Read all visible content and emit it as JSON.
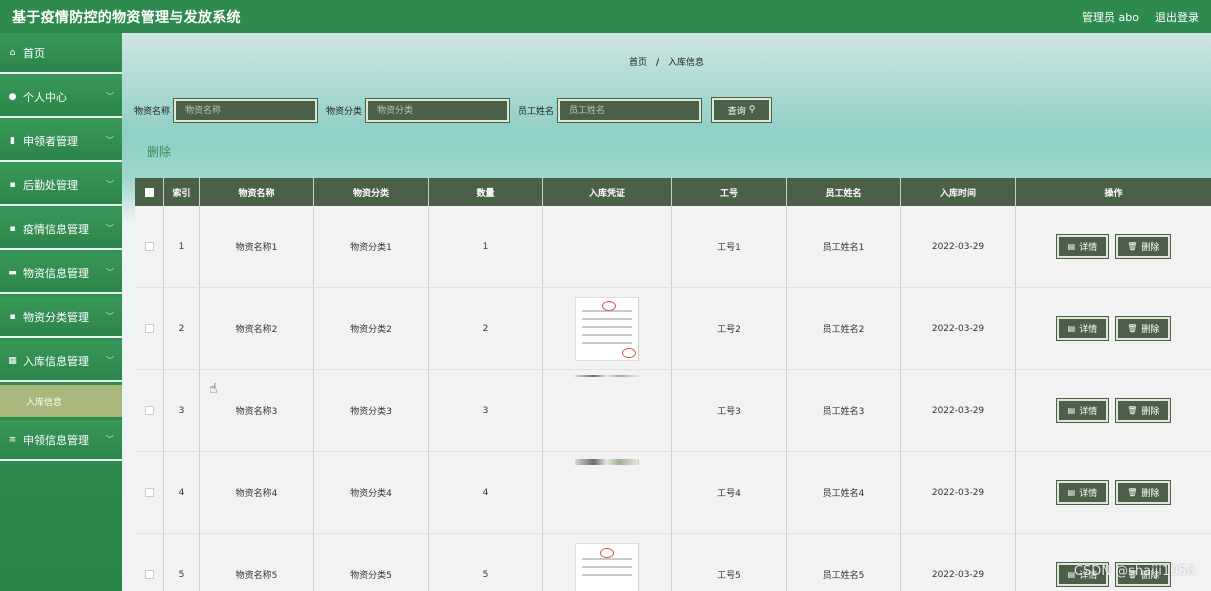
{
  "app": {
    "title": "基于疫情防控的物资管理与发放系统",
    "user_label": "管理员 abo",
    "logout_label": "退出登录"
  },
  "sidebar": {
    "items": [
      {
        "label": "首页",
        "icon": "home-icon"
      },
      {
        "label": "个人中心",
        "icon": "user-icon"
      },
      {
        "label": "申领者管理",
        "icon": "chart-icon"
      },
      {
        "label": "后勤处管理",
        "icon": "document-icon"
      },
      {
        "label": "疫情信息管理",
        "icon": "document-icon"
      },
      {
        "label": "物资信息管理",
        "icon": "box-icon"
      },
      {
        "label": "物资分类管理",
        "icon": "tag-icon"
      },
      {
        "label": "入库信息管理",
        "icon": "grid-icon"
      },
      {
        "label": "申领信息管理",
        "icon": "list-icon"
      }
    ],
    "active_sub": "入库信息"
  },
  "breadcrumb": {
    "home": "首页",
    "sep": "/",
    "current": "入库信息"
  },
  "search": {
    "name_label": "物资名称",
    "name_placeholder": "物资名称",
    "category_label": "物资分类",
    "category_placeholder": "物资分类",
    "employee_label": "员工姓名",
    "employee_placeholder": "员工姓名",
    "query_label": "查询"
  },
  "delete_link": "删除",
  "table": {
    "headers": [
      "索引",
      "物资名称",
      "物资分类",
      "数量",
      "入库凭证",
      "工号",
      "员工姓名",
      "入库时间",
      "操作"
    ],
    "detail_label": "详情",
    "delete_label": "删除",
    "rows": [
      {
        "idx": "1",
        "name": "物资名称1",
        "cat": "物资分类1",
        "qty": "1",
        "no": "工号1",
        "emp": "员工姓名1",
        "time": "2022-03-29"
      },
      {
        "idx": "2",
        "name": "物资名称2",
        "cat": "物资分类2",
        "qty": "2",
        "no": "工号2",
        "emp": "员工姓名2",
        "time": "2022-03-29"
      },
      {
        "idx": "3",
        "name": "物资名称3",
        "cat": "物资分类3",
        "qty": "3",
        "no": "工号3",
        "emp": "员工姓名3",
        "time": "2022-03-29"
      },
      {
        "idx": "4",
        "name": "物资名称4",
        "cat": "物资分类4",
        "qty": "4",
        "no": "工号4",
        "emp": "员工姓名4",
        "time": "2022-03-29"
      },
      {
        "idx": "5",
        "name": "物资名称5",
        "cat": "物资分类5",
        "qty": "5",
        "no": "工号5",
        "emp": "员工姓名5",
        "time": "2022-03-29"
      }
    ]
  },
  "watermark": "CSDN @shaiji1056",
  "colors": {
    "header": "#2e8a4e",
    "button": "#4a6148",
    "submenu": "#a9b77a"
  }
}
